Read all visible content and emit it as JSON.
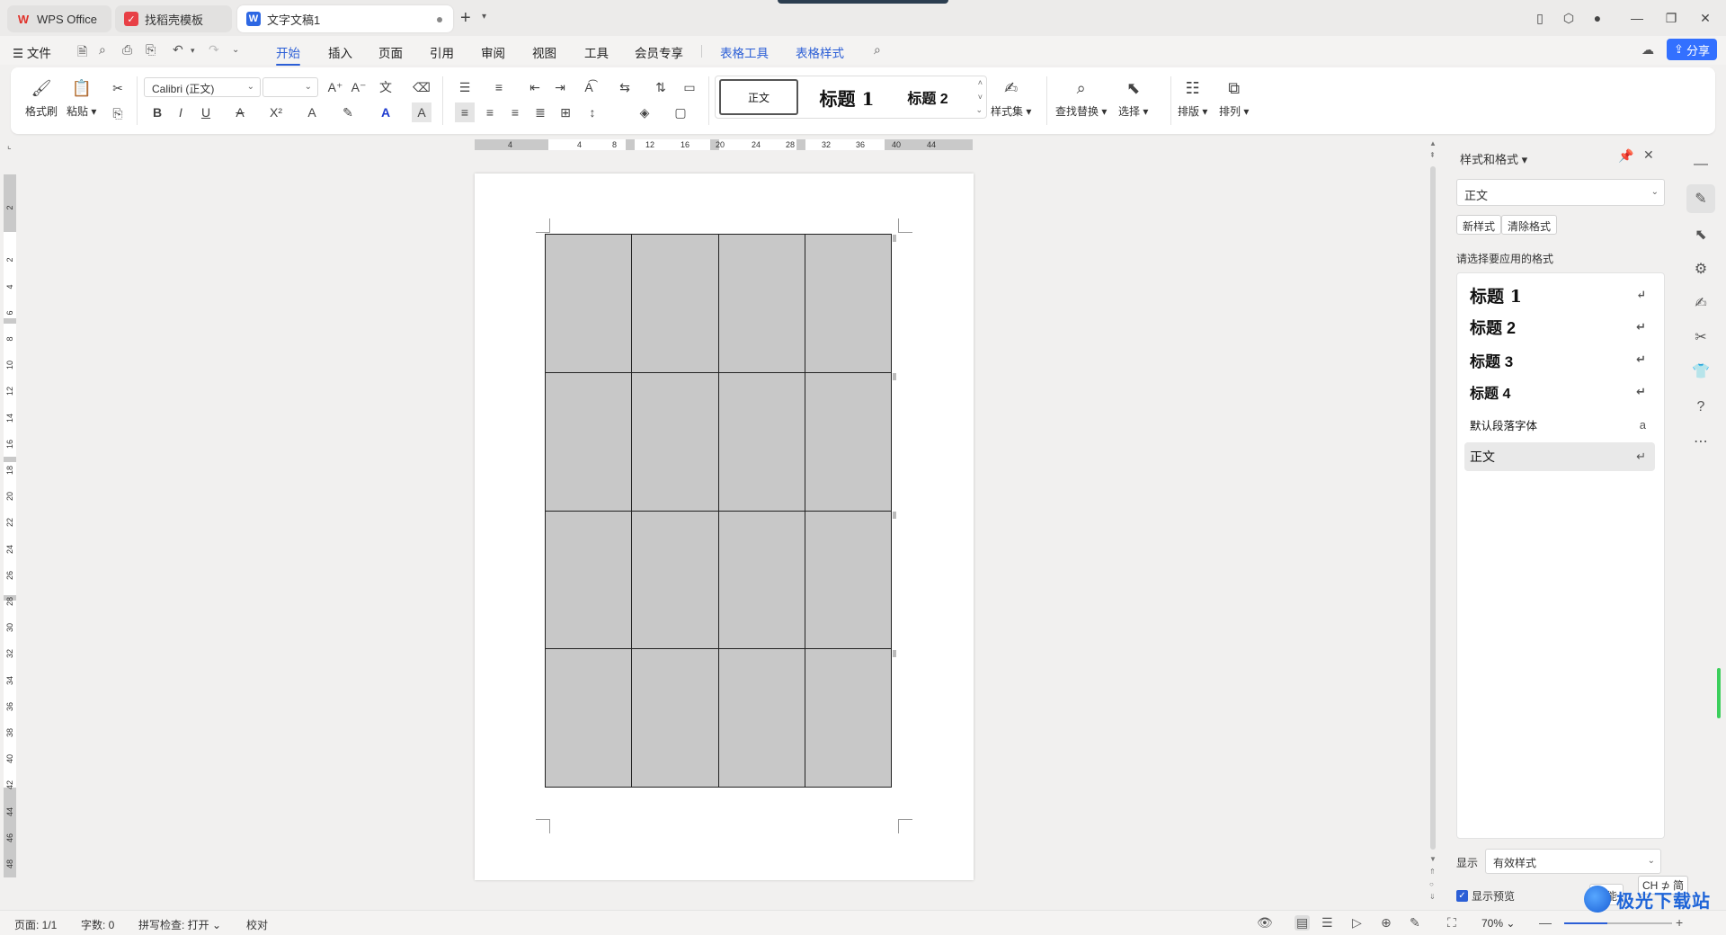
{
  "tabs": [
    {
      "label": "WPS Office"
    },
    {
      "label": "找稻壳模板"
    },
    {
      "label": "文字文稿1"
    }
  ],
  "menu": {
    "file": "文件",
    "items": [
      "开始",
      "插入",
      "页面",
      "引用",
      "审阅",
      "视图",
      "工具",
      "会员专享"
    ],
    "context": [
      "表格工具",
      "表格样式"
    ],
    "active": "开始",
    "share": "分享"
  },
  "ribbon": {
    "format_painter": "格式刷",
    "paste": "粘贴",
    "font_name": "Calibri (正文)",
    "font_size": "",
    "styles_gallery": {
      "normal": "正文",
      "h1": "标题 1",
      "h2": "标题 2"
    },
    "style_set": "样式集",
    "find_replace": "查找替换",
    "select": "选择",
    "layout": "排版",
    "arrange": "排列"
  },
  "ruler": {
    "horizontal": [
      "4",
      "4",
      "8",
      "12",
      "16",
      "20",
      "24",
      "28",
      "32",
      "36",
      "40",
      "44"
    ],
    "vertical": [
      "2",
      "2",
      "4",
      "6",
      "8",
      "10",
      "12",
      "14",
      "16",
      "18",
      "20",
      "22",
      "24",
      "26",
      "28",
      "30",
      "32",
      "34",
      "36",
      "38",
      "40",
      "42",
      "44",
      "46",
      "48"
    ]
  },
  "table": {
    "rows": 4,
    "cols": 4,
    "fill": "#c8c8c8"
  },
  "panel": {
    "title": "样式和格式",
    "current_style": "正文",
    "new_style": "新样式",
    "clear_format": "清除格式",
    "prompt": "请选择要应用的格式",
    "styles": [
      {
        "label": "标题 1",
        "mark": "↵"
      },
      {
        "label": "标题 2",
        "mark": "↵"
      },
      {
        "label": "标题 3",
        "mark": "↵"
      },
      {
        "label": "标题 4",
        "mark": "↵"
      },
      {
        "label": "默认段落字体",
        "mark": "a"
      },
      {
        "label": "正文",
        "mark": "↵"
      }
    ],
    "show_label": "显示",
    "show_value": "有效样式",
    "preview_label": "显示预览",
    "smart_label": "智能"
  },
  "status": {
    "page": "页面: 1/1",
    "words": "字数: 0",
    "spell": "拼写检查: 打开",
    "proof": "校对",
    "zoom": "70%"
  },
  "ime": "CH ⊅ 简",
  "watermark": "极光下载站"
}
